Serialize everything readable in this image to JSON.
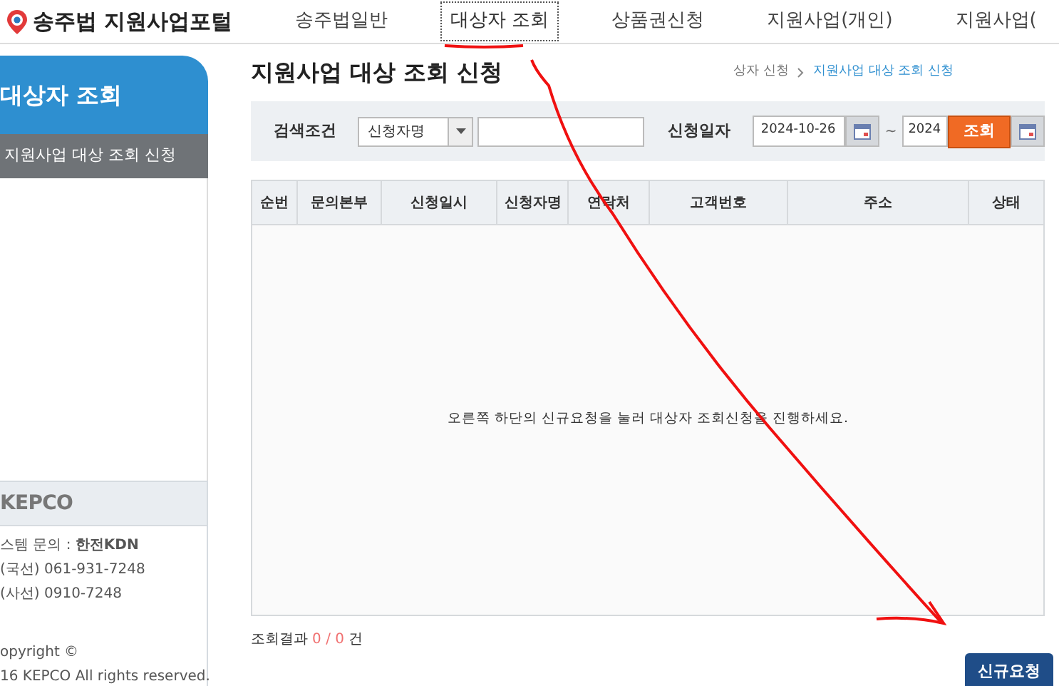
{
  "logo": {
    "title": "송주법 지원사업포털"
  },
  "nav": [
    {
      "label": "송주법일반",
      "selected": false
    },
    {
      "label": "대상자 조회",
      "selected": true
    },
    {
      "label": "상품권신청",
      "selected": false
    },
    {
      "label": "지원사업(개인)",
      "selected": false
    },
    {
      "label": "지원사업(",
      "selected": false
    }
  ],
  "sidebar": {
    "title": "대상자 조회",
    "items": [
      {
        "label": "지원사업 대상 조회 신청",
        "selected": true
      }
    ]
  },
  "footer_box": {
    "logo": "KEPCO",
    "lines": [
      "스템 문의 : **한전KDN**",
      "(국선) 061-931-7248",
      "(사선) 0910-7248"
    ],
    "copyright": [
      "opyright ©",
      "16 KEPCO All rights reserved."
    ]
  },
  "page": {
    "title": "지원사업 대상 조회 신청",
    "breadcrumb": [
      "상자 신청",
      "지원사업 대상 조회 신청"
    ]
  },
  "search": {
    "condition_label": "검색조건",
    "condition_value": "신청자명",
    "date_label": "신청일자",
    "date_from": "2024-10-26",
    "separator": "~",
    "date_to": "2024",
    "button": "조회"
  },
  "table": {
    "columns": [
      "순번",
      "문의본부",
      "신청일시",
      "신청자명",
      "연락처",
      "고객번호",
      "주소",
      "상태"
    ],
    "empty_message": "오른쪽 하단의 신규요청을 눌러 대상자 조회신청을 진행하세요."
  },
  "result": {
    "label": "조회결과",
    "shown": "0",
    "separator": "/",
    "total": "0",
    "unit": "건"
  },
  "new_request_button": "신규요청"
}
